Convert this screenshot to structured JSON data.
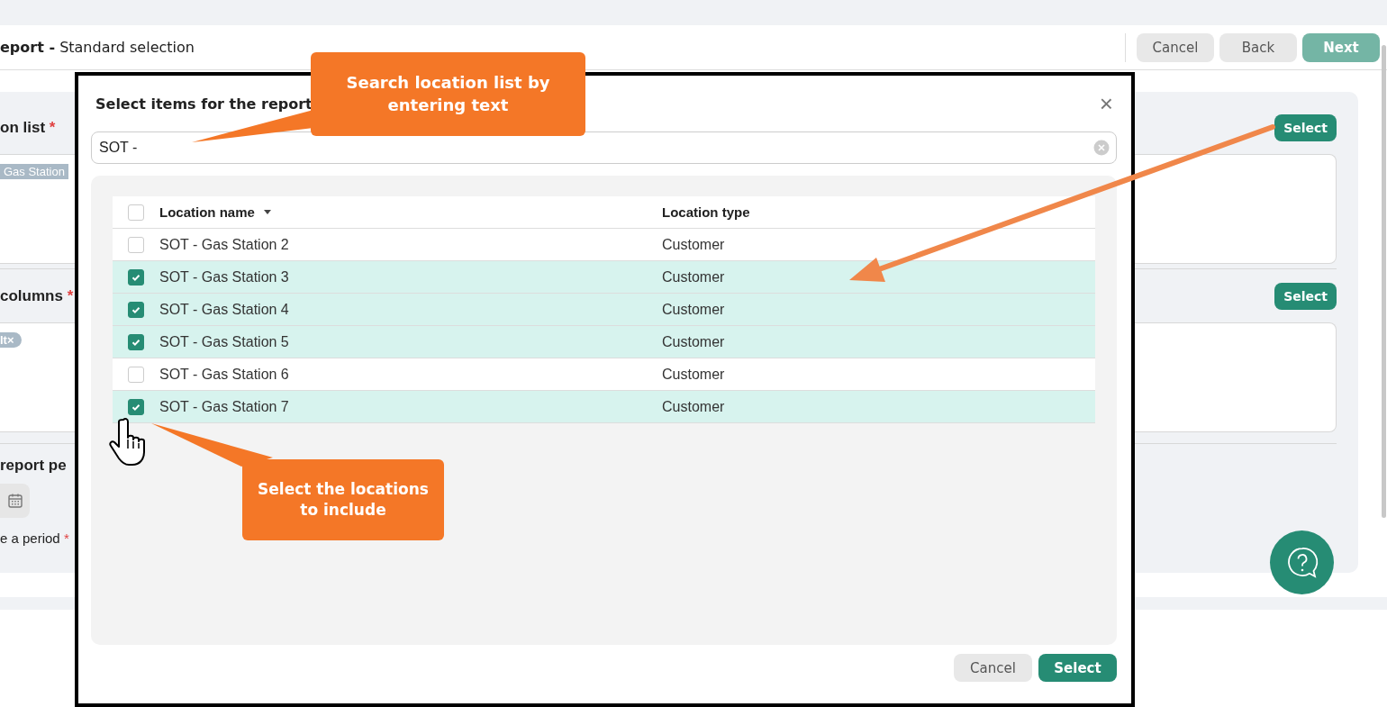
{
  "header": {
    "title": "**eport -** Standard selection",
    "buttons": [
      {
        "label": "Cancel",
        "kind": "plain",
        "disabled": false
      },
      {
        "label": "Back",
        "kind": "plain",
        "disabled": false
      },
      {
        "label": "Next",
        "kind": "primary",
        "disabled": true
      }
    ]
  },
  "sections": [
    {
      "kind": "list",
      "label": "on list",
      "mark": "*",
      "button": "Select",
      "tags": [
        {
          "text": "Gas Station"
        }
      ]
    },
    {
      "kind": "list",
      "label": "columns",
      "mark": "*",
      "button": "Select",
      "tags": [
        {
          "text": "lt",
          "remove": "×"
        }
      ]
    },
    {
      "kind": "period",
      "label": "report pe",
      "field_label": "e a period",
      "mark": "*"
    }
  ],
  "modal": {
    "title": "Select items for the report",
    "close": "×",
    "search": {
      "value": "SOT -"
    },
    "table": {
      "all_checked": false,
      "columns": [
        {
          "label": "Location name",
          "sorted": true
        },
        {
          "label": "Location type",
          "sorted": false
        }
      ],
      "rows": [
        {
          "name": "SOT - Gas Station 2",
          "type": "Customer",
          "checked": false
        },
        {
          "name": "SOT - Gas Station 3",
          "type": "Customer",
          "checked": true
        },
        {
          "name": "SOT - Gas Station 4",
          "type": "Customer",
          "checked": true
        },
        {
          "name": "SOT - Gas Station 5",
          "type": "Customer",
          "checked": true
        },
        {
          "name": "SOT - Gas Station 6",
          "type": "Customer",
          "checked": false
        },
        {
          "name": "SOT - Gas Station 7",
          "type": "Customer",
          "checked": true
        }
      ]
    },
    "buttons": [
      {
        "label": "Cancel",
        "kind": "plain"
      },
      {
        "label": "Select",
        "kind": "primary"
      }
    ]
  },
  "callouts": [
    "Search location list by entering text",
    "Select the locations to include"
  ]
}
